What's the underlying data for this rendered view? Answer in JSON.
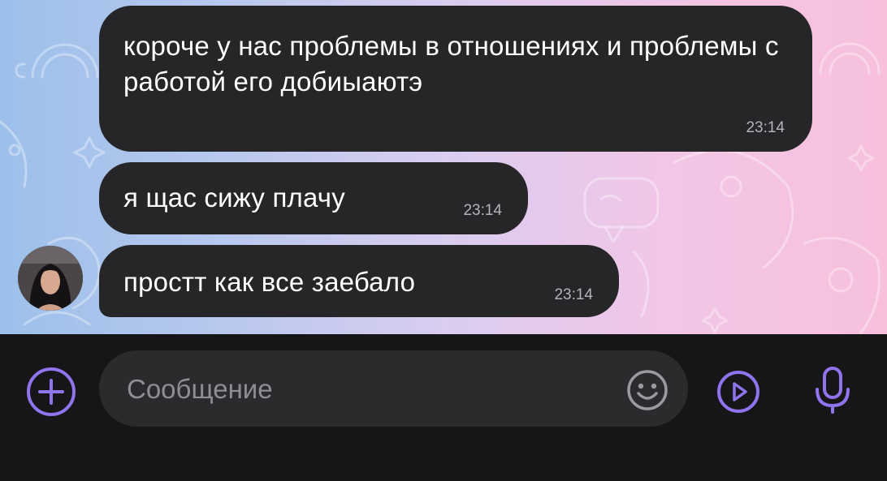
{
  "messages": [
    {
      "text": "короче у нас проблемы в отношениях и проблемы с работой его добиыаютэ",
      "time": "23:14"
    },
    {
      "text": "я щас сижу плачу",
      "time": "23:14"
    },
    {
      "text": "простт как все заебало",
      "time": "23:14"
    }
  ],
  "composer": {
    "placeholder": "Сообщение"
  },
  "colors": {
    "bubble": "#262628",
    "accent": "#8f74ee",
    "time": "#b4b4b8",
    "input_bg": "#2b2b2e",
    "bar_bg": "#161618"
  },
  "icons": {
    "attach": "plus-circle-icon",
    "emoji": "smile-icon",
    "video": "video-message-icon",
    "voice": "microphone-icon"
  }
}
